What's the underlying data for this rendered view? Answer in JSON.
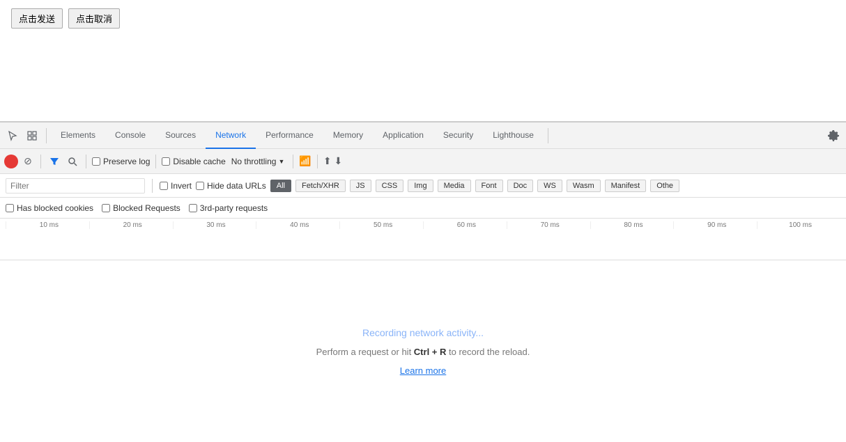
{
  "page": {
    "send_button": "点击发送",
    "cancel_button": "点击取消"
  },
  "devtools": {
    "tabs": [
      {
        "id": "elements",
        "label": "Elements",
        "active": false
      },
      {
        "id": "console",
        "label": "Console",
        "active": false
      },
      {
        "id": "sources",
        "label": "Sources",
        "active": false
      },
      {
        "id": "network",
        "label": "Network",
        "active": true
      },
      {
        "id": "performance",
        "label": "Performance",
        "active": false
      },
      {
        "id": "memory",
        "label": "Memory",
        "active": false
      },
      {
        "id": "application",
        "label": "Application",
        "active": false
      },
      {
        "id": "security",
        "label": "Security",
        "active": false
      },
      {
        "id": "lighthouse",
        "label": "Lighthouse",
        "active": false
      }
    ],
    "toolbar": {
      "preserve_log_label": "Preserve log",
      "disable_cache_label": "Disable cache",
      "throttle_label": "No throttling"
    },
    "filter": {
      "placeholder": "Filter",
      "invert_label": "Invert",
      "hide_data_urls_label": "Hide data URLs",
      "types": [
        "All",
        "Fetch/XHR",
        "JS",
        "CSS",
        "Img",
        "Media",
        "Font",
        "Doc",
        "WS",
        "Wasm",
        "Manifest",
        "Othe"
      ]
    },
    "blocked": {
      "has_blocked_cookies": "Has blocked cookies",
      "blocked_requests": "Blocked Requests",
      "third_party": "3rd-party requests"
    },
    "timeline": {
      "ticks": [
        "10 ms",
        "20 ms",
        "30 ms",
        "40 ms",
        "50 ms",
        "60 ms",
        "70 ms",
        "80 ms",
        "90 ms",
        "100 ms"
      ]
    },
    "empty_state": {
      "recording": "Recording network activity...",
      "hint": "Perform a request or hit ",
      "shortcut": "Ctrl + R",
      "hint_end": " to record the reload.",
      "learn_more": "Learn more"
    }
  }
}
